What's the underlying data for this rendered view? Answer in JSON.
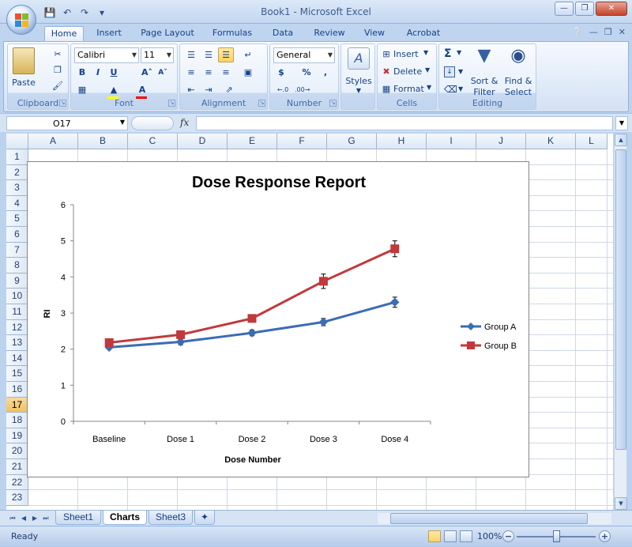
{
  "window": {
    "title": "Book1 - Microsoft Excel",
    "buttons": [
      "—",
      "❐",
      "✕"
    ]
  },
  "quick_access": [
    "save-icon",
    "undo-icon",
    "redo-icon",
    "customize-icon"
  ],
  "ribbon_tabs": [
    "Home",
    "Insert",
    "Page Layout",
    "Formulas",
    "Data",
    "Review",
    "View",
    "Acrobat"
  ],
  "active_tab": "Home",
  "ribbon": {
    "clipboard": {
      "label": "Clipboard",
      "paste": "Paste"
    },
    "font": {
      "label": "Font",
      "name": "Calibri",
      "size": "11",
      "bold": "B",
      "italic": "I",
      "underline": "U"
    },
    "alignment": {
      "label": "Alignment"
    },
    "number": {
      "label": "Number",
      "format": "General",
      "currency": "$",
      "percent": "%",
      "comma": ","
    },
    "styles": {
      "label": "Styles"
    },
    "cells": {
      "label": "Cells",
      "insert": "Insert",
      "delete": "Delete",
      "format": "Format"
    },
    "editing": {
      "label": "Editing",
      "sort_filter_1": "Sort &",
      "sort_filter_2": "Filter",
      "find_select_1": "Find &",
      "find_select_2": "Select"
    }
  },
  "formula_bar": {
    "name_box": "O17",
    "fx": "fx",
    "value": ""
  },
  "grid": {
    "columns": [
      "A",
      "B",
      "C",
      "D",
      "E",
      "F",
      "G",
      "H",
      "I",
      "J",
      "K",
      "L"
    ],
    "rows": [
      "1",
      "2",
      "3",
      "4",
      "5",
      "6",
      "7",
      "8",
      "9",
      "10",
      "11",
      "12",
      "13",
      "14",
      "15",
      "16",
      "17",
      "18",
      "19",
      "20",
      "21",
      "22",
      "23"
    ],
    "selected_row": "17"
  },
  "chart_data": {
    "type": "line",
    "title": "Dose Response Report",
    "xlabel": "Dose Number",
    "ylabel": "RI",
    "categories": [
      "Baseline",
      "Dose 1",
      "Dose 2",
      "Dose 3",
      "Dose 4"
    ],
    "ylim": [
      0,
      6
    ],
    "yticks": [
      "0",
      "1",
      "2",
      "3",
      "4",
      "5",
      "6"
    ],
    "grid": false,
    "legend": "right",
    "series": [
      {
        "name": "Group A",
        "color": "#3b6db5",
        "marker": "diamond",
        "values": [
          2.05,
          2.2,
          2.45,
          2.75,
          3.3
        ],
        "errors": [
          0.05,
          0.08,
          0.08,
          0.1,
          0.14
        ]
      },
      {
        "name": "Group B",
        "color": "#c0393b",
        "marker": "square",
        "values": [
          2.18,
          2.4,
          2.85,
          3.88,
          4.78
        ],
        "errors": [
          0.05,
          0.05,
          0.07,
          0.2,
          0.22
        ]
      }
    ]
  },
  "sheet_tabs": [
    "Sheet1",
    "Charts",
    "Sheet3"
  ],
  "active_sheet": "Charts",
  "status": {
    "text": "Ready",
    "zoom": "100%"
  }
}
